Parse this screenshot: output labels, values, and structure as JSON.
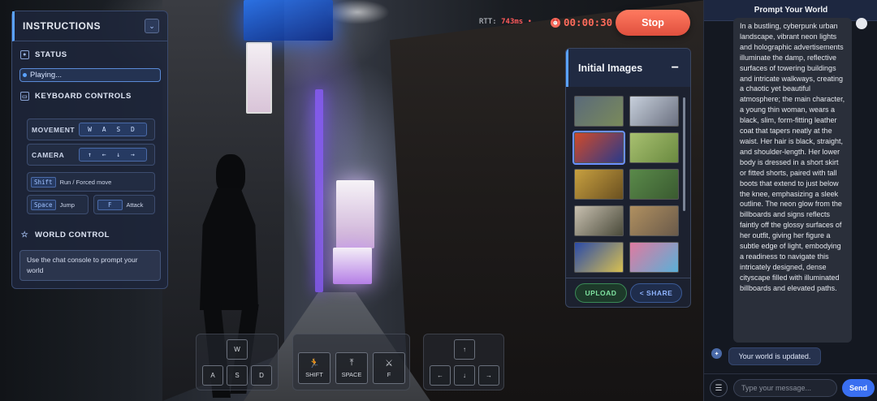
{
  "instructions": {
    "title": "INSTRUCTIONS",
    "collapse_icon": "⌄",
    "status_title": "STATUS",
    "status_value": "Playing...",
    "keyboard_title": "KEYBOARD CONTROLS",
    "movement_label": "MOVEMENT",
    "movement_keys": "W A S D",
    "camera_label": "CAMERA",
    "camera_keys": "↑ ← ↓ →",
    "shift_key": "Shift",
    "shift_action": "Run / Forced move",
    "space_key": "Space",
    "space_action": "Jump",
    "f_key": "F",
    "f_action": "Attack",
    "world_title": "WORLD CONTROL",
    "world_text": "Use the chat console to prompt your world"
  },
  "topbar": {
    "rtt_label": "RTT:",
    "rtt_value": "743ms",
    "rtt_dot": "•",
    "timer": "00:00:30",
    "stop_label": "Stop"
  },
  "images_panel": {
    "title": "Initial Images",
    "collapse_label": "−",
    "upload_label": "UPLOAD",
    "share_label": "< SHARE",
    "thumbnails": [
      {
        "name": "castle-landscape",
        "colors": [
          "#5a6a7a",
          "#7a8a5a"
        ]
      },
      {
        "name": "snowy-village",
        "colors": [
          "#c8d0dc",
          "#6a7080"
        ]
      },
      {
        "name": "neon-street",
        "colors": [
          "#d04a2a",
          "#2a3a8a"
        ]
      },
      {
        "name": "sunny-meadow",
        "colors": [
          "#a8c070",
          "#6a8a40"
        ]
      },
      {
        "name": "golden-field",
        "colors": [
          "#c8a040",
          "#6a5020"
        ]
      },
      {
        "name": "forest-temple",
        "colors": [
          "#5a8a4a",
          "#3a5a30"
        ]
      },
      {
        "name": "winter-painting",
        "colors": [
          "#c8c0b0",
          "#4a4a3a"
        ]
      },
      {
        "name": "riverside-town",
        "colors": [
          "#b09060",
          "#6a5a4a"
        ]
      },
      {
        "name": "starry-night",
        "colors": [
          "#2a4aa8",
          "#d8c050"
        ]
      },
      {
        "name": "colorful-houses",
        "colors": [
          "#e07aa0",
          "#5ab0d8"
        ]
      }
    ]
  },
  "keypads": {
    "w": "W",
    "a": "A",
    "s": "S",
    "d": "D",
    "shift": "SHIFT",
    "space": "SPACE",
    "f": "F",
    "up": "↑",
    "left": "←",
    "down": "↓",
    "right": "→"
  },
  "chat": {
    "title": "Prompt Your World",
    "prompt_text": "In a bustling, cyberpunk urban landscape, vibrant neon lights and holographic advertisements illuminate the damp, reflective surfaces of towering buildings and intricate walkways, creating a chaotic yet beautiful atmosphere; the main character, a young thin woman, wears a black, slim, form-fitting leather coat that tapers neatly at the waist. Her hair is black, straight, and shoulder-length. Her lower body is dressed in a short skirt or fitted shorts, paired with tall boots that extend to just below the knee, emphasizing a sleek outline. The neon glow from the billboards and signs reflects faintly off the glossy surfaces of her outfit, giving her figure a subtle edge of light, embodying a readiness to navigate this intricately designed, dense cityscape filled with illuminated billboards and elevated paths.",
    "system_message": "Your world is updated.",
    "input_placeholder": "Type your message...",
    "send_label": "Send"
  }
}
